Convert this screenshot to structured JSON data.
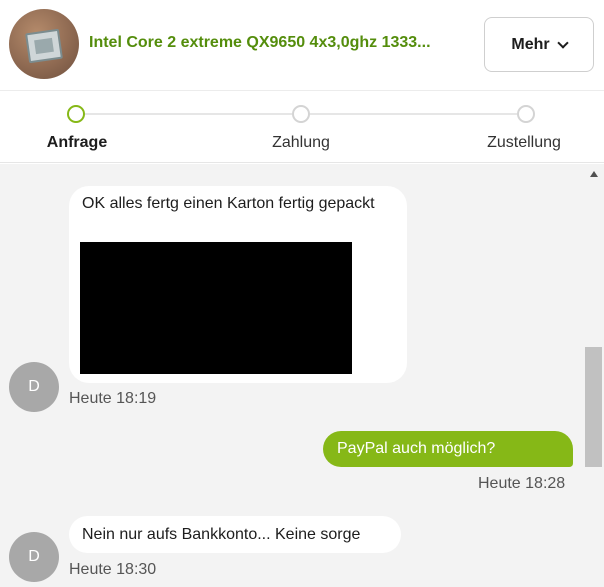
{
  "header": {
    "product_title": "Intel Core 2 extreme QX9650 4x3,0ghz 1333...",
    "more_button_label": "Mehr"
  },
  "stepper": {
    "steps": [
      {
        "label": "Anfrage",
        "active": true
      },
      {
        "label": "Zahlung",
        "active": false
      },
      {
        "label": "Zustellung",
        "active": false
      }
    ]
  },
  "colors": {
    "accent": "#86b817",
    "title_green": "#548d0c",
    "chat_background": "#f3f3f3"
  },
  "messages": [
    {
      "direction": "incoming",
      "avatar_initial": "D",
      "text": "OK alles fertg einen Karton fertig gepackt",
      "has_image": true,
      "time": "Heute 18:19"
    },
    {
      "direction": "outgoing",
      "text": "PayPal auch möglich?",
      "time": "Heute 18:28"
    },
    {
      "direction": "incoming",
      "avatar_initial": "D",
      "text": "Nein nur aufs Bankkonto... Keine sorge",
      "time": "Heute 18:30"
    }
  ]
}
